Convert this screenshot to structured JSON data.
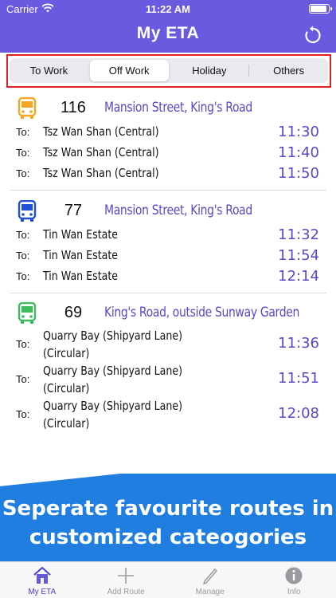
{
  "status_bar": {
    "carrier": "Carrier",
    "time": "11:22 AM"
  },
  "header": {
    "title": "My ETA"
  },
  "segments": {
    "items": [
      "To Work",
      "Off Work",
      "Holiday",
      "Others"
    ],
    "selected": "Off Work"
  },
  "routes": [
    {
      "number": "116",
      "stop": "Mansion Street, King's Road",
      "icon_color": "#f5a623",
      "etas": [
        {
          "to": "To:",
          "destination": "Tsz Wan Shan (Central)",
          "time": "11:30"
        },
        {
          "to": "To:",
          "destination": "Tsz Wan Shan (Central)",
          "time": "11:40"
        },
        {
          "to": "To:",
          "destination": "Tsz Wan Shan (Central)",
          "time": "11:50"
        }
      ]
    },
    {
      "number": "77",
      "stop": "Mansion Street, King's Road",
      "icon_color": "#1f4fd8",
      "etas": [
        {
          "to": "To:",
          "destination": "Tin Wan Estate",
          "time": "11:32"
        },
        {
          "to": "To:",
          "destination": "Tin Wan Estate",
          "time": "11:54"
        },
        {
          "to": "To:",
          "destination": "Tin Wan Estate",
          "time": "12:14"
        }
      ]
    },
    {
      "number": "69",
      "stop": "King's Road, outside Sunway Garden",
      "icon_color": "#3dbd5a",
      "etas": [
        {
          "to": "To:",
          "destination": "Quarry Bay (Shipyard Lane)\n(Circular)",
          "time": "11:36"
        },
        {
          "to": "To:",
          "destination": "Quarry Bay (Shipyard Lane)\n(Circular)",
          "time": "11:51"
        },
        {
          "to": "To:",
          "destination": "Quarry Bay (Shipyard Lane)\n(Circular)",
          "time": "12:08"
        }
      ]
    }
  ],
  "banner": {
    "line1": "Seperate favourite routes in",
    "line2": "customized cateogories"
  },
  "tabbar": {
    "items": [
      {
        "label": "My ETA",
        "icon": "home-icon",
        "active": true
      },
      {
        "label": "Add Route",
        "icon": "plus-icon",
        "active": false
      },
      {
        "label": "Manage",
        "icon": "pencil-icon",
        "active": false
      },
      {
        "label": "Info",
        "icon": "info-icon",
        "active": false
      }
    ]
  },
  "colors": {
    "header": "#6a5ae0",
    "accent": "#5a48c8",
    "banner": "#1f7ee0",
    "highlight_outline": "#e02020"
  }
}
